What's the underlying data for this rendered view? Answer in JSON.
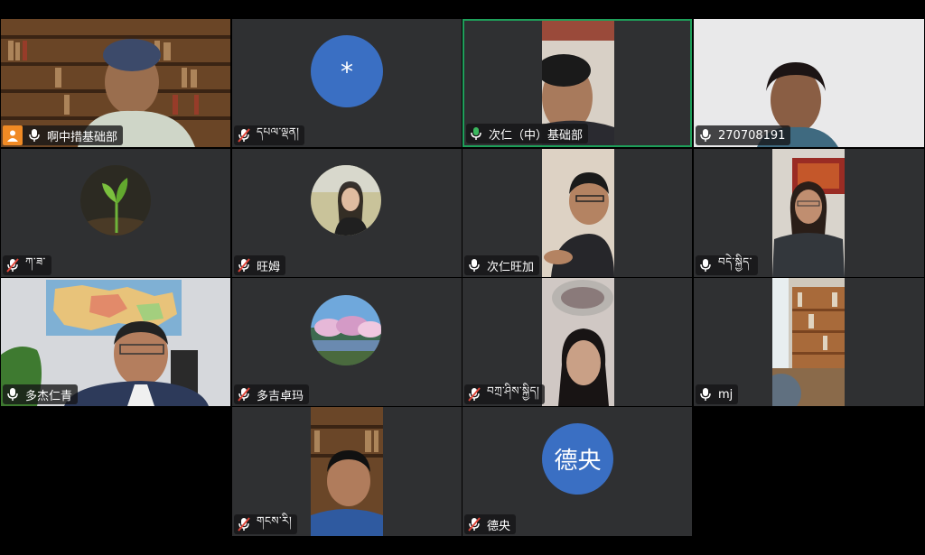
{
  "colors": {
    "background": "#000000",
    "tile": "#2f3032",
    "active_speaker_border": "#1e9f5a",
    "avatar_blue": "#3a6fc3",
    "host_badge": "#f08a24",
    "mic_muted": "#e0463a",
    "mic_active": "#3bb85e"
  },
  "participants": [
    {
      "name": "啊中措基础部",
      "mic": "on",
      "host": true
    },
    {
      "name": "དཔལ་ལྡན།",
      "mic": "muted",
      "avatar_text": "*"
    },
    {
      "name": "次仁（中）基础部",
      "mic": "speaking",
      "active_speaker": true
    },
    {
      "name": "270708191",
      "mic": "on"
    },
    {
      "name": "ཀ་ཟ་",
      "mic": "muted"
    },
    {
      "name": "旺姆",
      "mic": "muted"
    },
    {
      "name": "次仁旺加",
      "mic": "on"
    },
    {
      "name": "བདེ་སྐྱིད་",
      "mic": "on"
    },
    {
      "name": "多杰仁青",
      "mic": "on"
    },
    {
      "name": "多吉卓玛",
      "mic": "muted"
    },
    {
      "name": "བཀྲ་ཤིས་སྐྱིད།",
      "mic": "muted"
    },
    {
      "name": "mj",
      "mic": "on"
    },
    {
      "name": "གངས་རི།",
      "mic": "muted"
    },
    {
      "name": "德央",
      "mic": "muted",
      "avatar_text": "德央"
    }
  ]
}
